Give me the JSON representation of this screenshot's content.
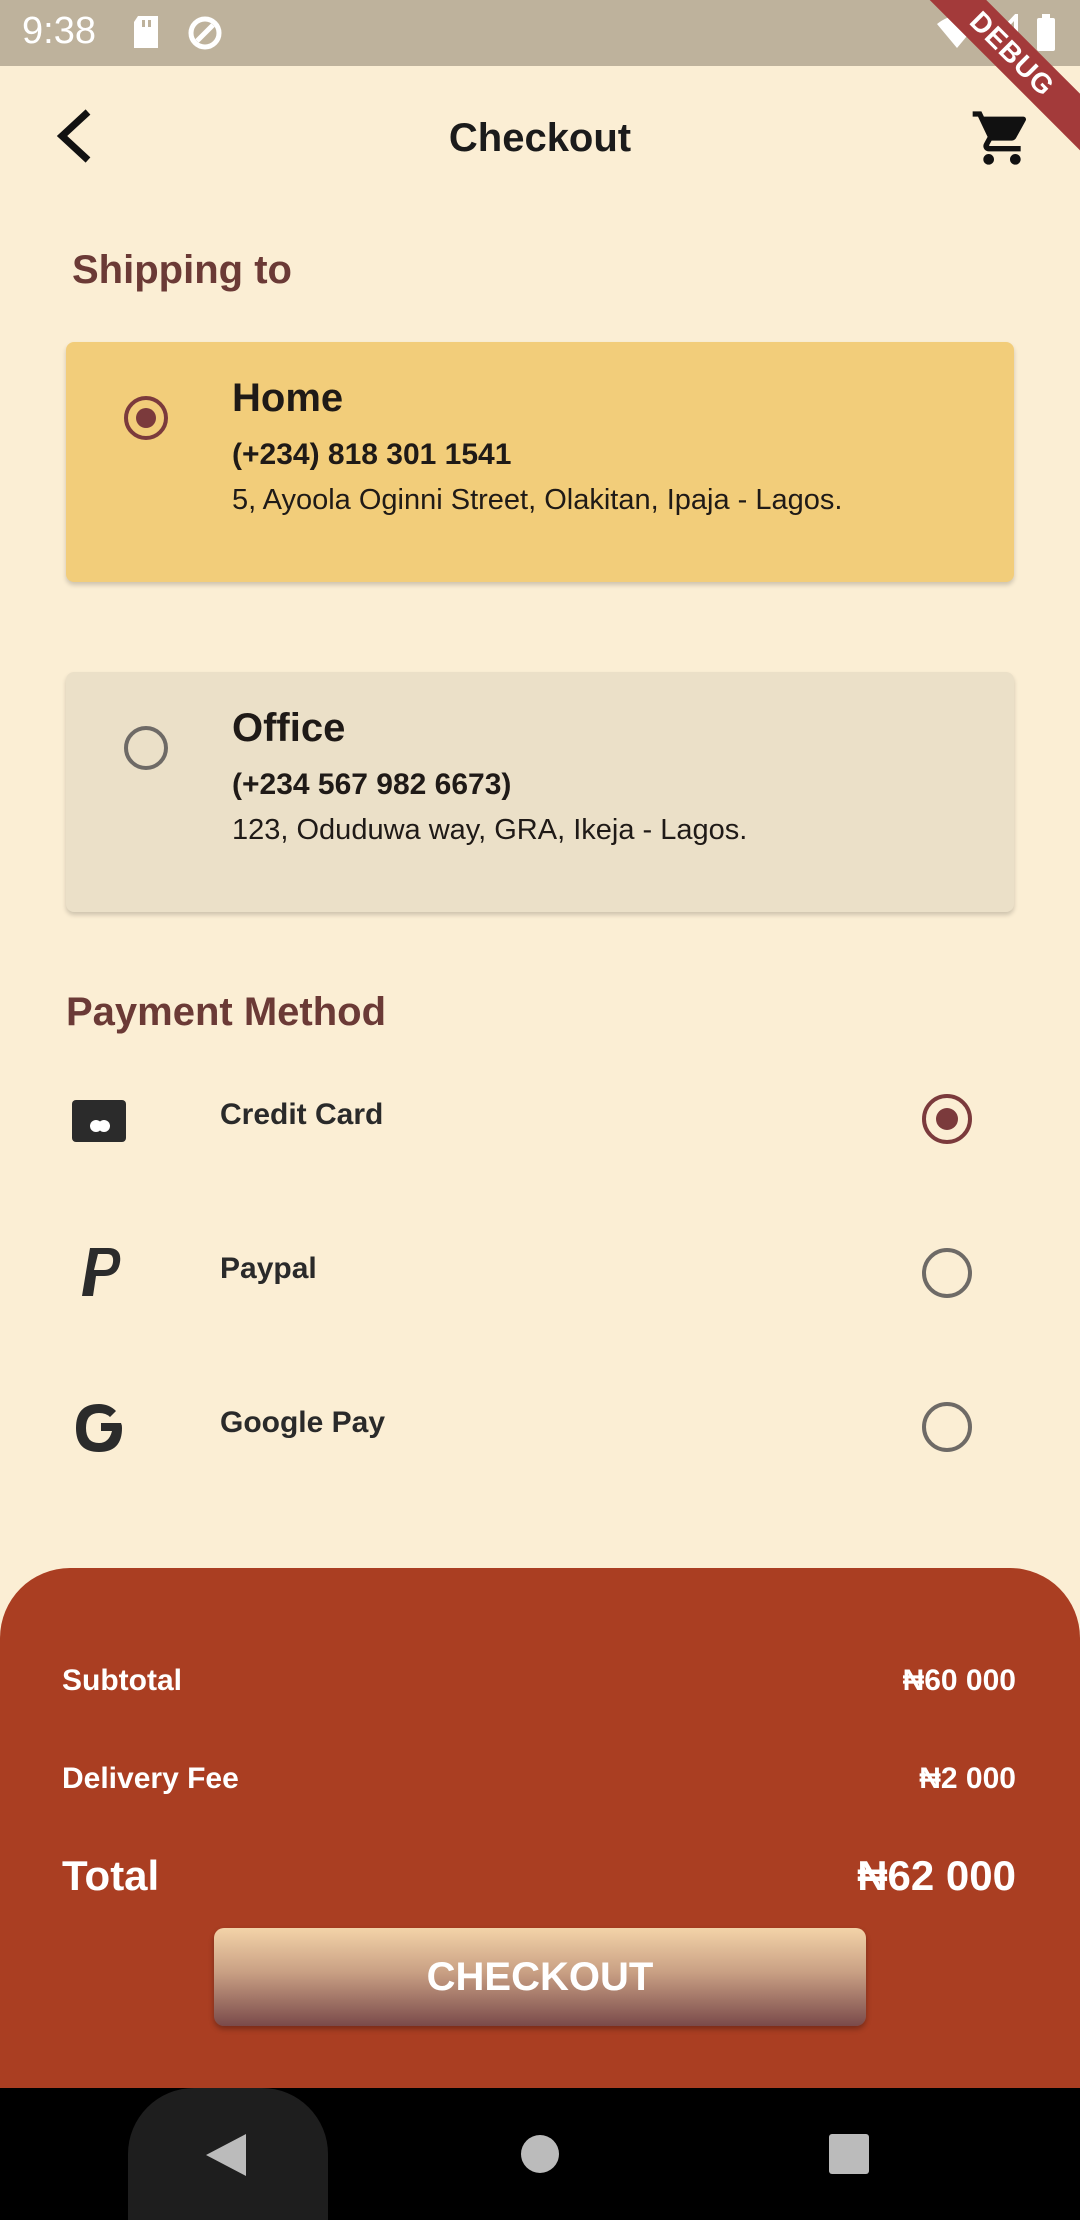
{
  "status_bar": {
    "time": "9:38",
    "debug_label": "DEBUG"
  },
  "header": {
    "title": "Checkout"
  },
  "shipping": {
    "title": "Shipping to",
    "addresses": [
      {
        "name": "Home",
        "phone": "(+234) 818 301 1541",
        "address": "5, Ayoola Oginni Street, Olakitan, Ipaja - Lagos.",
        "selected": true
      },
      {
        "name": "Office",
        "phone": "(+234 567 982 6673)",
        "address": "123, Oduduwa way, GRA, Ikeja - Lagos.",
        "selected": false
      }
    ]
  },
  "payment": {
    "title": "Payment Method",
    "methods": [
      {
        "label": "Credit Card",
        "icon": "credit-card-icon",
        "selected": true
      },
      {
        "label": "Paypal",
        "icon": "paypal-icon",
        "selected": false
      },
      {
        "label": "Google Pay",
        "icon": "google-icon",
        "selected": false
      }
    ]
  },
  "summary": {
    "subtotal_label": "Subtotal",
    "subtotal_value": "₦60 000",
    "delivery_label": "Delivery Fee",
    "delivery_value": "₦2 000",
    "total_label": "Total",
    "total_value": "₦62 000",
    "checkout_label": "CHECKOUT"
  },
  "colors": {
    "background": "#FBEED4",
    "accent": "#AA3E22",
    "selected_card": "#F2CD7A",
    "unselected_card": "#EBE0C8",
    "section_title": "#6B3A36",
    "radio_selected": "#7B3A3C"
  }
}
